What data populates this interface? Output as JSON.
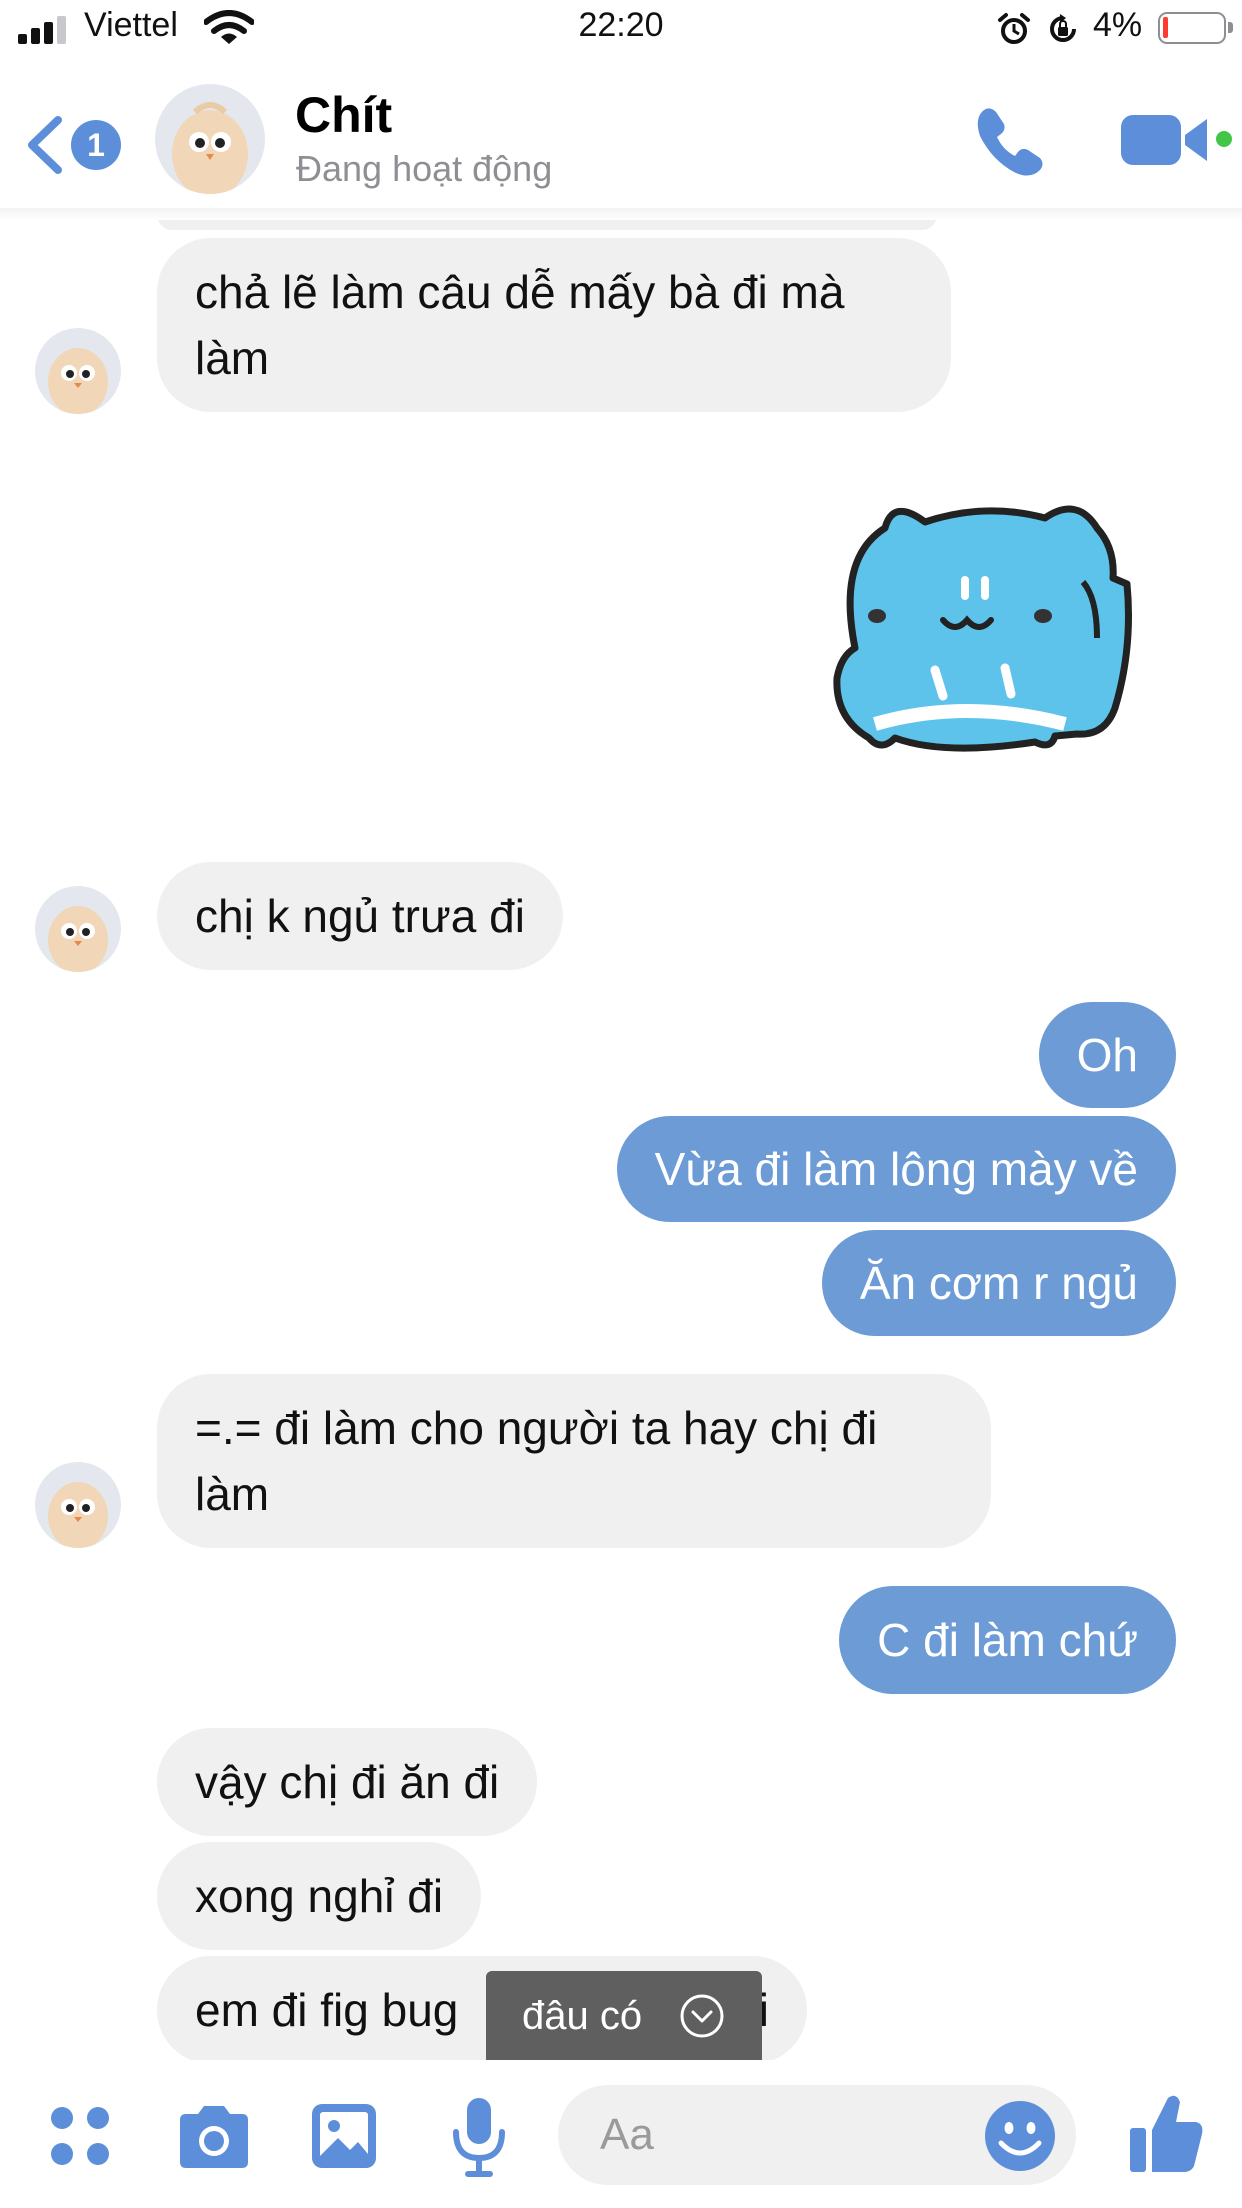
{
  "status_bar": {
    "carrier": "Viettel",
    "time": "22:20",
    "battery_percent": "4%"
  },
  "header": {
    "back_badge": "1",
    "contact_name": "Chít",
    "contact_status": "Đang hoạt động"
  },
  "messages": [
    {
      "side": "in",
      "text": "chả lẽ làm câu dễ mấy bà đi mà làm"
    },
    {
      "side": "out",
      "sticker": "blue-cat-sticker"
    },
    {
      "side": "in",
      "text": "chị k ngủ trưa đi"
    },
    {
      "side": "out",
      "text": "Oh"
    },
    {
      "side": "out",
      "text": "Vừa đi làm lông mày về"
    },
    {
      "side": "out",
      "text": "Ăn cơm r ngủ"
    },
    {
      "side": "in",
      "text": "=.= đi làm cho người ta hay chị đi làm"
    },
    {
      "side": "out",
      "text": "C đi làm chứ"
    },
    {
      "side": "in",
      "text": "vậy chị đi ăn đi"
    },
    {
      "side": "in",
      "text": "xong nghỉ đi"
    },
    {
      "side": "in",
      "text": "em đi fig bug",
      "trailing_text": "i"
    }
  ],
  "toast": {
    "text": "đâu có",
    "icon": "chevron-down-circle-icon"
  },
  "composer": {
    "placeholder": "Aa",
    "icons": [
      "apps-icon",
      "camera-icon",
      "photo-icon",
      "microphone-icon",
      "emoji-icon",
      "thumbs-up-icon"
    ]
  },
  "colors": {
    "accent": "#5d8ed9",
    "outgoing_bubble": "#6c9bd6",
    "incoming_bubble": "#f0f0f0",
    "online": "#44c547"
  }
}
